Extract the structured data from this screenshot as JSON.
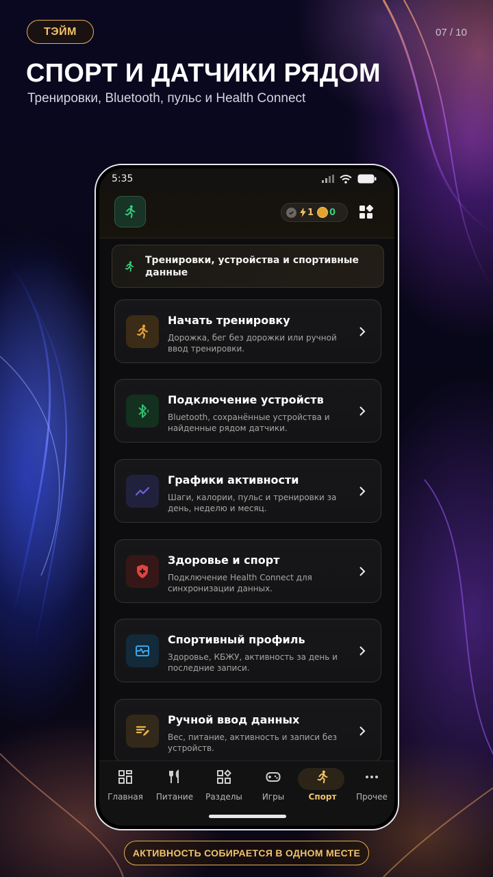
{
  "slide": {
    "brand": "ТЭЙМ",
    "counter": "07 / 10",
    "headline": "СПОРТ И ДАТЧИКИ РЯДОМ",
    "subheadline": "Тренировки, Bluetooth, пульс и Health Connect",
    "footer": "АКТИВНОСТЬ СОБИРАЕТСЯ В ОДНОМ МЕСТЕ"
  },
  "status_bar": {
    "time": "5:35"
  },
  "header": {
    "logo_icon": "running-person-icon",
    "bolt_count": "1",
    "coin_count": "0"
  },
  "section_banner": {
    "icon": "running-person-icon",
    "text": "Тренировки, устройства и спортивные данные"
  },
  "cards": [
    {
      "icon": "running-person-icon",
      "title": "Начать тренировку",
      "description": "Дорожка, бег без дорожки или ручной ввод тренировки."
    },
    {
      "icon": "bluetooth-icon",
      "title": "Подключение устройств",
      "description": "Bluetooth, сохранённые устройства и найденные рядом датчики."
    },
    {
      "icon": "trending-chart-icon",
      "title": "Графики активности",
      "description": "Шаги, калории, пульс и тренировки за день, неделю и месяц."
    },
    {
      "icon": "health-shield-icon",
      "title": "Здоровье и спорт",
      "description": "Подключение Health Connect для синхронизации данных."
    },
    {
      "icon": "pulse-monitor-icon",
      "title": "Спортивный профиль",
      "description": "Здоровье, КБЖУ, активность за день и последние записи."
    },
    {
      "icon": "edit-note-icon",
      "title": "Ручной ввод данных",
      "description": "Вес, питание, активность и записи без устройств."
    }
  ],
  "colors": {
    "accent": "#f3c26a",
    "green": "#34d07a",
    "card_icons": [
      "#e8a13a",
      "#2fbf6e",
      "#6a66e0",
      "#e0453f",
      "#3ea6e6",
      "#e8b54a"
    ]
  },
  "bottom_nav": [
    {
      "label": "Главная",
      "icon": "dashboard-icon"
    },
    {
      "label": "Питание",
      "icon": "fork-knife-icon"
    },
    {
      "label": "Разделы",
      "icon": "categories-icon"
    },
    {
      "label": "Игры",
      "icon": "gamepad-icon"
    },
    {
      "label": "Спорт",
      "icon": "running-person-icon",
      "active": true
    },
    {
      "label": "Прочее",
      "icon": "more-dots-icon"
    }
  ]
}
